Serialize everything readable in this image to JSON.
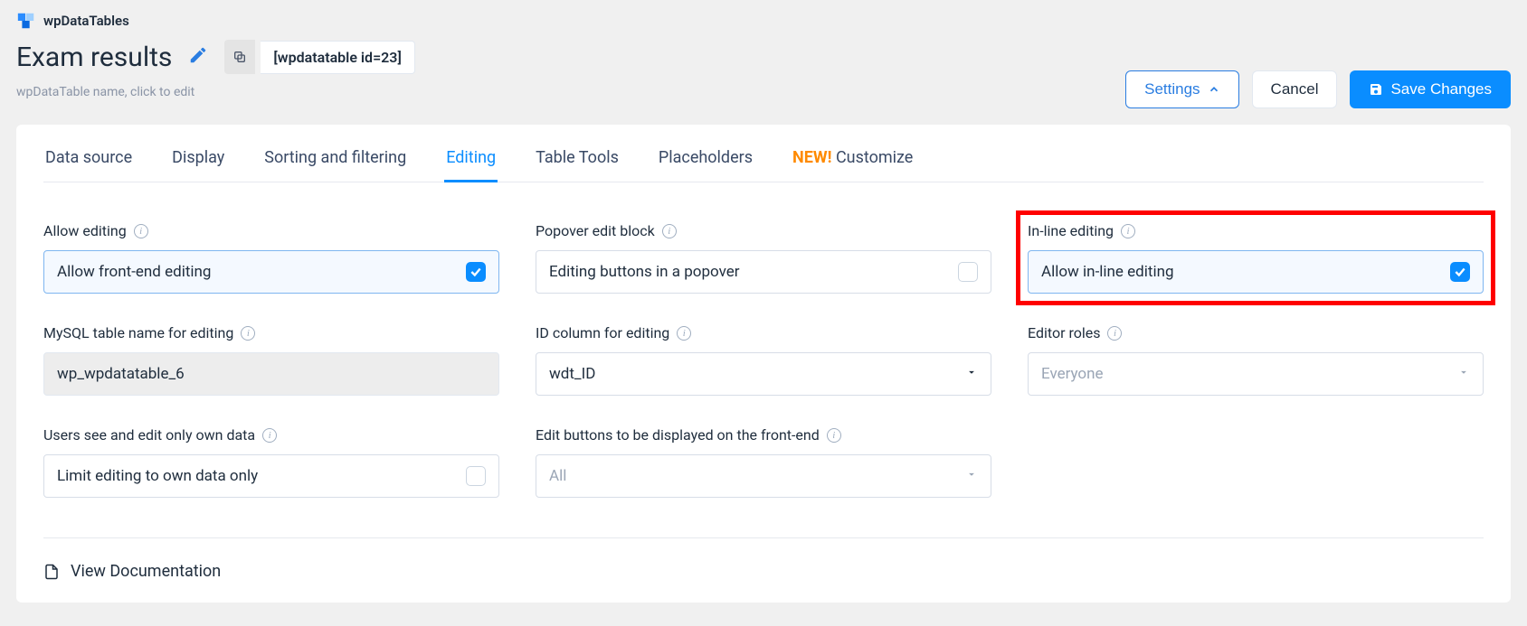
{
  "brand": {
    "name": "wpDataTables"
  },
  "header": {
    "title": "Exam results",
    "shortcode": "[wpdatatable id=23]",
    "name_hint": "wpDataTable name, click to edit"
  },
  "actions": {
    "settings": "Settings",
    "cancel": "Cancel",
    "save": "Save Changes"
  },
  "tabs": {
    "data_source": "Data source",
    "display": "Display",
    "sorting": "Sorting and filtering",
    "editing": "Editing",
    "tools": "Table Tools",
    "placeholders": "Placeholders",
    "new_tag": "NEW!",
    "customize": "Customize"
  },
  "fields": {
    "allow_editing": {
      "label": "Allow editing",
      "value": "Allow front-end editing",
      "checked": true
    },
    "popover_edit": {
      "label": "Popover edit block",
      "value": "Editing buttons in a popover",
      "checked": false
    },
    "inline_editing": {
      "label": "In-line editing",
      "value": "Allow in-line editing",
      "checked": true
    },
    "mysql_table": {
      "label": "MySQL table name for editing",
      "value": "wp_wpdatatable_6"
    },
    "id_column": {
      "label": "ID column for editing",
      "value": "wdt_ID"
    },
    "editor_roles": {
      "label": "Editor roles",
      "placeholder": "Everyone"
    },
    "own_data": {
      "label": "Users see and edit only own data",
      "value": "Limit editing to own data only",
      "checked": false
    },
    "edit_buttons": {
      "label": "Edit buttons to be displayed on the front-end",
      "value": "All"
    }
  },
  "footer": {
    "view_doc": "View Documentation"
  }
}
